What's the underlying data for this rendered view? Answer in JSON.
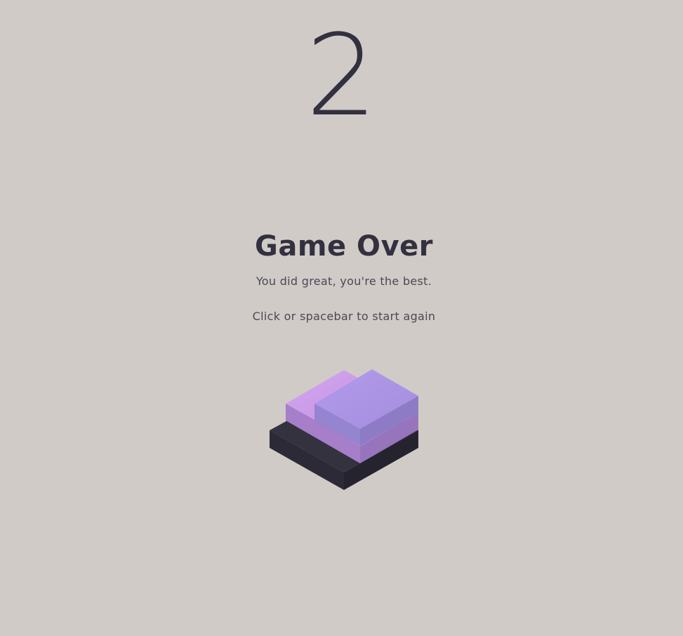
{
  "game": {
    "score": "2",
    "title": "Game Over",
    "subtitle": "You did great, you're the best.",
    "hint": "Click or spacebar to start again"
  },
  "colors": {
    "background": "#d0cbc7",
    "text_dark": "#33313f",
    "text_soft": "#4a4856",
    "base_top": "#34323f",
    "base_left": "#2c2a36",
    "base_right": "#25232e",
    "mid_top": "#c697e6",
    "mid_left": "#a77ec9",
    "mid_right": "#9775bd",
    "top_top": "#ab92e2",
    "top_left": "#9584cf",
    "top_right": "#8e7bc6"
  }
}
